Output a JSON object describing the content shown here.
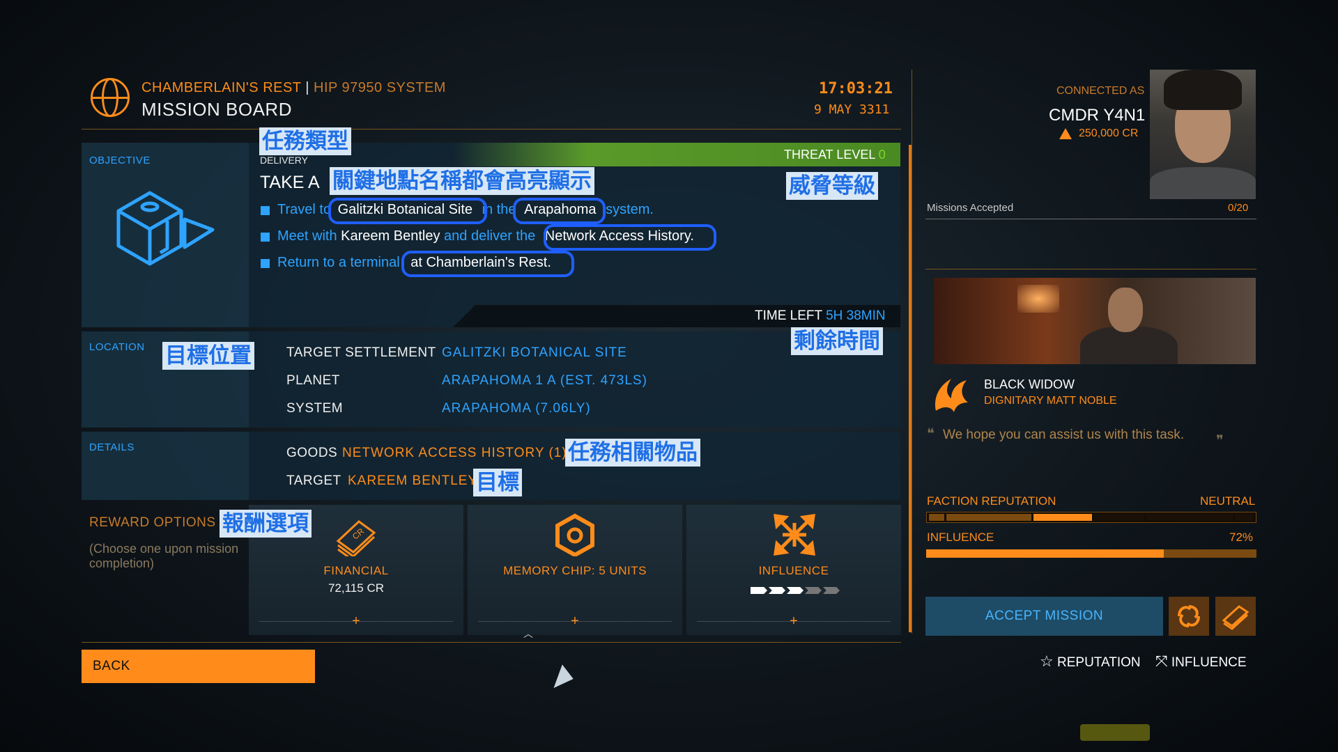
{
  "header": {
    "station": "CHAMBERLAIN'S REST",
    "separator": "|",
    "system": "HIP 97950 SYSTEM",
    "title": "MISSION BOARD",
    "time": "17:03:21",
    "date": "9 MAY 3311"
  },
  "objective": {
    "section_label": "OBJECTIVE",
    "type": "DELIVERY",
    "title_prefix": "TAKE A",
    "threat_label": "THREAT LEVEL",
    "threat_value": "0",
    "lines": [
      {
        "pre": "Travel to",
        "hl1": "Galitzki Botanical Site",
        "mid": "in the",
        "hl2": "Arapahoma",
        "post": "system."
      },
      {
        "pre": "Meet with",
        "hl1": "Kareem Bentley",
        "mid": "and deliver the",
        "hl2": "Network Access History",
        "post": "."
      },
      {
        "pre": "Return to a terminal",
        "hl1": "at Chamberlain's Rest",
        "post": "."
      }
    ],
    "time_left_label": "TIME LEFT",
    "time_left_value": "5H 38MIN"
  },
  "location": {
    "section_label": "LOCATION",
    "rows": [
      {
        "key": "TARGET SETTLEMENT",
        "value": "GALITZKI BOTANICAL SITE"
      },
      {
        "key": "PLANET",
        "value": "ARAPAHOMA 1 A (EST. 473LS)"
      },
      {
        "key": "SYSTEM",
        "value": "ARAPAHOMA (7.06LY)"
      }
    ]
  },
  "details": {
    "section_label": "DETAILS",
    "goods_label": "GOODS",
    "goods_value": "NETWORK ACCESS HISTORY (1)",
    "target_label": "TARGET",
    "target_value": "KAREEM BENTLEY"
  },
  "rewards": {
    "label": "REWARD OPTIONS",
    "hint": "(Choose one upon mission completion)",
    "options": [
      {
        "name": "FINANCIAL",
        "sub": "72,115 CR",
        "icon": "credit-chips-icon"
      },
      {
        "name": "MEMORY CHIP: 5 UNITS",
        "sub": "",
        "icon": "commodity-hex-icon"
      },
      {
        "name": "INFLUENCE",
        "sub": "",
        "icon": "influence-arrows-icon",
        "level": 3,
        "max": 5
      }
    ],
    "plus": "+"
  },
  "annotations": {
    "mission_type": "任務類型",
    "highlight_note": "關鍵地點名稱都會高亮顯示",
    "threat": "威脅等級",
    "time_left": "剩餘時間",
    "location": "目標位置",
    "goods": "任務相關物品",
    "target": "目標",
    "rewards": "報酬選項"
  },
  "commander": {
    "connected_as": "CONNECTED AS",
    "name": "CMDR Y4N1",
    "credits": "250,000 CR",
    "missions_label": "Missions Accepted",
    "missions_count": "0/20"
  },
  "faction": {
    "name": "BLACK WIDOW",
    "role": "DIGNITARY MATT NOBLE",
    "quote": "We hope you can assist us with this task.",
    "reputation_label": "FACTION REPUTATION",
    "reputation_value": "NEUTRAL",
    "influence_label": "INFLUENCE",
    "influence_value": "72%",
    "influence_fraction": 0.72
  },
  "actions": {
    "accept": "ACCEPT MISSION",
    "back": "BACK",
    "legend_reputation": "REPUTATION",
    "legend_influence": "INFLUENCE"
  },
  "colors": {
    "accent": "#ff8c1a",
    "info": "#2ea3ff",
    "threat": "#7bd530",
    "annotation": "#1f5fff"
  }
}
